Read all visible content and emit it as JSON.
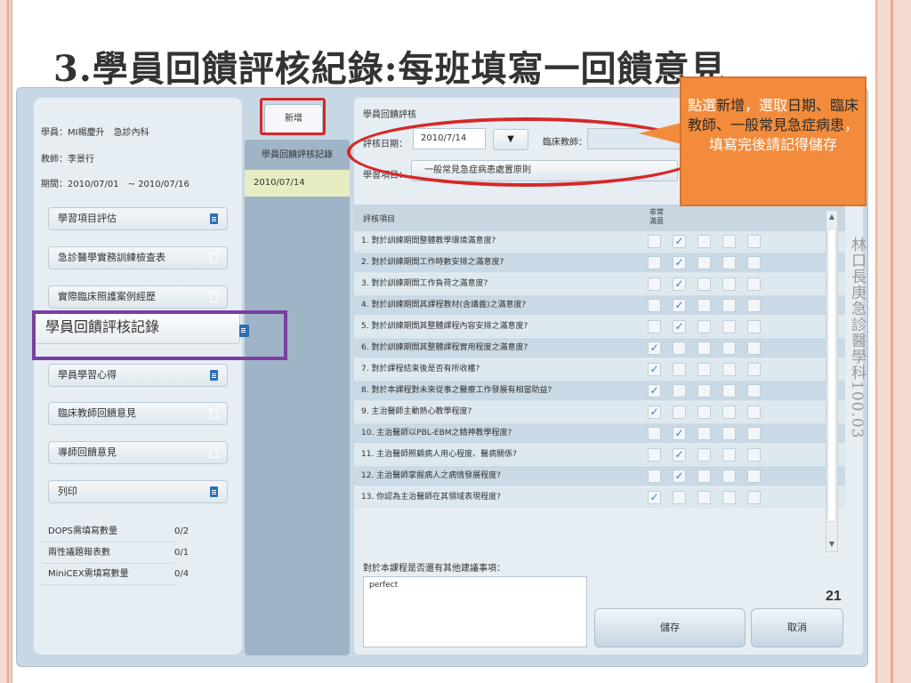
{
  "slide": {
    "title": "3.學員回饋評核紀錄:每班填寫一回饋意見",
    "page_number": "21",
    "vertical_caption": "林口長庚急診醫學科100.03"
  },
  "left_panel": {
    "student": "學員：MI楊慶升　急診內科",
    "teacher": "教師：李景行",
    "period": "期間：2010/07/01　~ 2010/07/16",
    "menu_items": [
      {
        "label": "學習項目評估",
        "icon": "doc-filled-icon"
      },
      {
        "label": "急診醫學實務訓練檢查表",
        "icon": "doc-outline-icon"
      },
      {
        "label": "實際臨床照護案例經歷",
        "icon": "doc-outline-icon"
      },
      {
        "label": "學員回饋評核記錄",
        "icon": "doc-filled-icon"
      },
      {
        "label": "學員學習心得",
        "icon": "doc-filled-icon"
      },
      {
        "label": "臨床教師回饋意見",
        "icon": "doc-outline-icon"
      },
      {
        "label": "導師回饋意見",
        "icon": "doc-outline-icon"
      },
      {
        "label": "列印",
        "icon": "doc-filled-icon"
      }
    ],
    "stats": [
      {
        "label": "DOPS需填寫數量",
        "value": "0/2"
      },
      {
        "label": "兩性議題報表數",
        "value": "0/1"
      },
      {
        "label": "MiniCEX需填寫數量",
        "value": "0/4"
      }
    ]
  },
  "middle_panel": {
    "add_button": "新增",
    "header": "學員回饋評核記錄",
    "records": [
      "2010/07/14"
    ]
  },
  "form": {
    "title": "學員回饋評核",
    "date_label": "評核日期：",
    "date_value": "2010/7/14",
    "dropdown_arrow": "▼",
    "teacher_label": "臨床教師：",
    "item_label": "學習項目：",
    "item_value": "一般常見急症病患處置原則",
    "table_header": "評核項目",
    "col_header": "非常滿意",
    "rows": [
      {
        "label": "1. 對於訓練期間整體教學環境滿意度?",
        "checked": 1
      },
      {
        "label": "2. 對於訓練期間工作時數安排之滿意度?",
        "checked": 1
      },
      {
        "label": "3. 對於訓練期間工作負荷之滿意度?",
        "checked": 1
      },
      {
        "label": "4. 對於訓練期間其課程教材(含講義)之滿意度?",
        "checked": 1
      },
      {
        "label": "5. 對於訓練期間其整體課程內容安排之滿意度?",
        "checked": 1
      },
      {
        "label": "6. 對於訓練期間其整體課程實用程度之滿意度?",
        "checked": 0
      },
      {
        "label": "7. 對於課程結束後是否有所收穫?",
        "checked": 0
      },
      {
        "label": "8. 對於本課程對未來從事之醫療工作發展有相當助益?",
        "checked": 0
      },
      {
        "label": "9. 主治醫師主動熱心教學程度?",
        "checked": 0
      },
      {
        "label": "10. 主治醫師以PBL-EBM之精神教學程度?",
        "checked": 1
      },
      {
        "label": "11. 主治醫師照顧病人用心程度、醫病關係?",
        "checked": 1
      },
      {
        "label": "12. 主治醫師掌握病人之病情發展程度?",
        "checked": 1
      },
      {
        "label": "13. 你認為主治醫師在其領域表現程度?",
        "checked": 0
      }
    ],
    "check_mark": "✓",
    "comment_label": "對於本課程是否還有其他建議事項：",
    "comment_value": "perfect",
    "save_button": "儲存",
    "cancel_button": "取消",
    "scroll_up": "▲",
    "scroll_down": "▼"
  },
  "callout": {
    "segments": [
      {
        "text": "點選",
        "color": "#ffffff"
      },
      {
        "text": "新增",
        "color": "#2a2a2a"
      },
      {
        "text": "，",
        "color": "#ffffff"
      },
      {
        "text": "選取",
        "color": "#ffffff"
      },
      {
        "text": "日期、臨床教師、一般常見急症病患",
        "color": "#2a2a2a"
      },
      {
        "text": "，填寫完後請記得儲存",
        "color": "#ffffff"
      }
    ]
  },
  "colors": {
    "accent_red": "#d62828",
    "accent_purple": "#7a3fa0",
    "callout_orange": "#f28c3c",
    "check_blue": "#3a7ec4"
  }
}
